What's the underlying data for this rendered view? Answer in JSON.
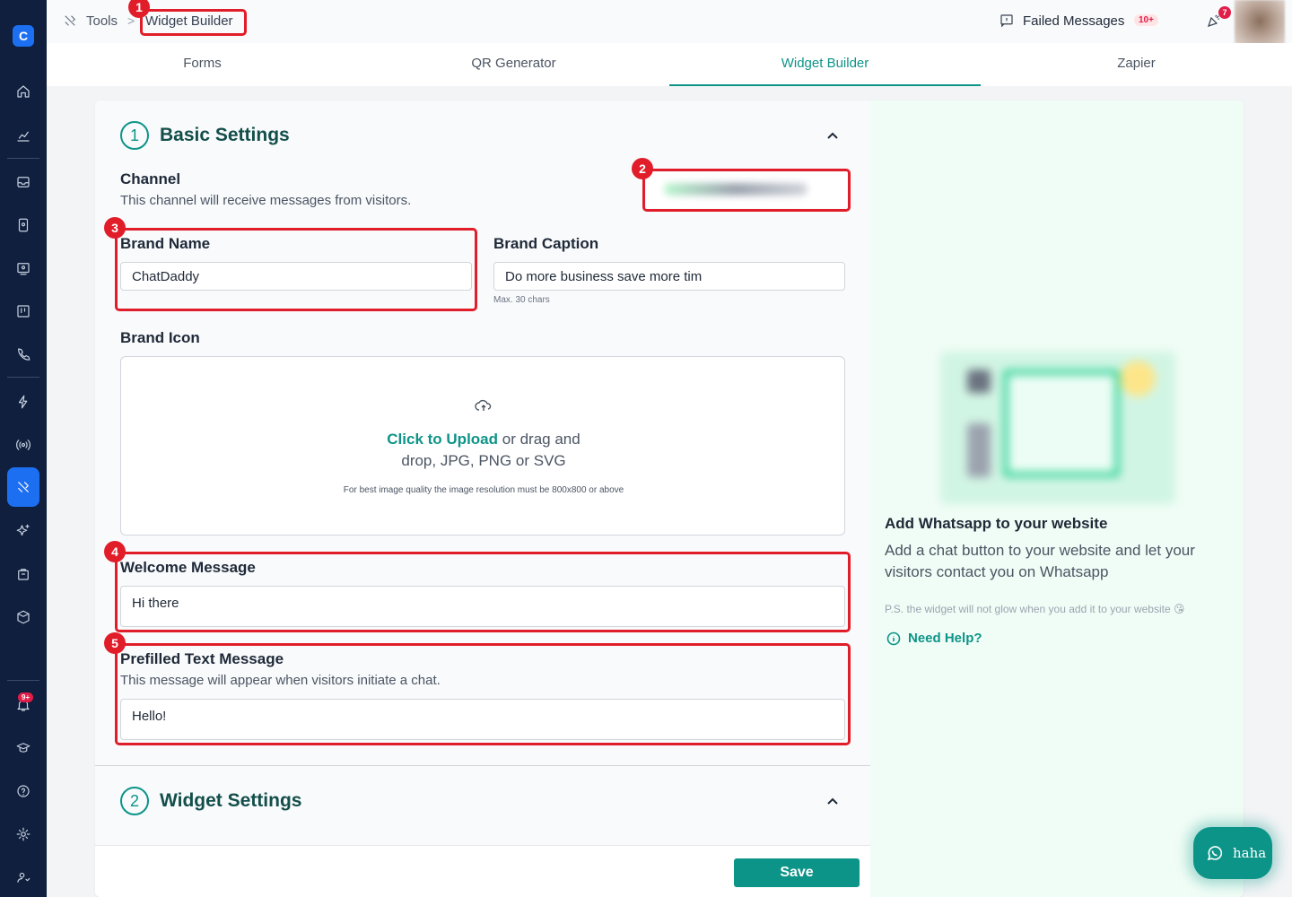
{
  "breadcrumb": {
    "tools": "Tools",
    "separator": ">",
    "current": "Widget Builder"
  },
  "header": {
    "failed_messages": "Failed Messages",
    "failed_count": "10+",
    "notification_count": "7"
  },
  "sidebar": {
    "logo_letter": "C",
    "notification_badge": "9+",
    "active_item": "tools"
  },
  "tabs": [
    {
      "label": "Forms",
      "active": false
    },
    {
      "label": "QR Generator",
      "active": false
    },
    {
      "label": "Widget Builder",
      "active": true
    },
    {
      "label": "Zapier",
      "active": false
    }
  ],
  "basic_settings": {
    "number": "1",
    "title": "Basic Settings",
    "channel_label": "Channel",
    "channel_desc": "This channel will receive messages from visitors.",
    "brand_name_label": "Brand Name",
    "brand_name_value": "ChatDaddy",
    "brand_caption_label": "Brand Caption",
    "brand_caption_value": "Do more business save more tim",
    "brand_caption_hint": "Max. 30 chars",
    "brand_icon_label": "Brand Icon",
    "upload_link": "Click to Upload",
    "upload_rest": " or drag and",
    "upload_line2": "drop, JPG, PNG or SVG",
    "upload_hint": "For best image quality the image resolution must be 800x800 or above",
    "welcome_label": "Welcome Message",
    "welcome_value": "Hi there",
    "prefilled_label": "Prefilled Text Message",
    "prefilled_desc": "This message will appear when visitors initiate a chat.",
    "prefilled_value": "Hello!"
  },
  "widget_settings": {
    "number": "2",
    "title": "Widget Settings"
  },
  "footer": {
    "save_label": "Save"
  },
  "preview": {
    "title": "Add Whatsapp to your website",
    "description": "Add a chat button to your website and let your visitors contact you on Whatsapp",
    "ps": "P.S. the widget will not glow when you add it to your website 😘",
    "help": "Need Help?"
  },
  "whatsapp_widget": {
    "label": "haha"
  },
  "annotations": [
    "1",
    "2",
    "3",
    "4",
    "5"
  ],
  "colors": {
    "accent": "#0d9488",
    "sidebar": "#0f1f3d",
    "annotation": "#e11d2a",
    "preview_bg": "#f0fdf6"
  }
}
